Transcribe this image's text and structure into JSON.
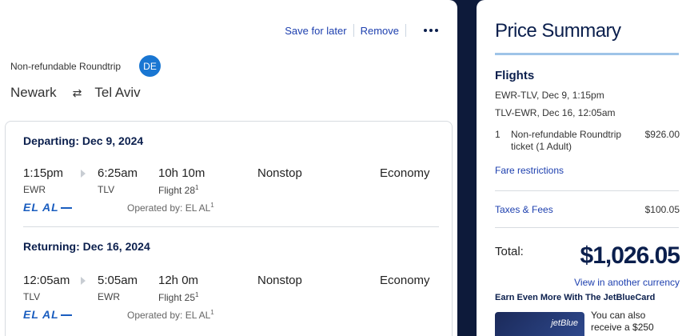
{
  "actions": {
    "save_label": "Save for later",
    "remove_label": "Remove"
  },
  "trip": {
    "type": "Non-refundable Roundtrip",
    "avatar_initials": "DE",
    "origin": "Newark",
    "destination": "Tel Aviv"
  },
  "segments": [
    {
      "title": "Departing: Dec 9, 2024",
      "depart_time": "1:15pm",
      "depart_code": "EWR",
      "arrive_time": "6:25am",
      "arrive_code": "TLV",
      "duration": "10h 10m",
      "flight": "Flight 28",
      "stops": "Nonstop",
      "cabin": "Economy",
      "airline_logo": "EL AL",
      "operated_by": "Operated by: EL AL"
    },
    {
      "title": "Returning: Dec 16, 2024",
      "depart_time": "12:05am",
      "depart_code": "TLV",
      "arrive_time": "5:05am",
      "arrive_code": "EWR",
      "duration": "12h 0m",
      "flight": "Flight 25",
      "stops": "Nonstop",
      "cabin": "Economy",
      "airline_logo": "EL AL",
      "operated_by": "Operated by: EL AL"
    }
  ],
  "footnote_marker": "1",
  "summary": {
    "title": "Price Summary",
    "flights_heading": "Flights",
    "legs": [
      "EWR-TLV, Dec 9, 1:15pm",
      "TLV-EWR, Dec 16, 12:05am"
    ],
    "ticket_qty": "1",
    "ticket_desc": "Non-refundable Roundtrip ticket (1 Adult)",
    "ticket_price": "$926.00",
    "fare_restrictions": "Fare restrictions",
    "taxes_label": "Taxes & Fees",
    "taxes_value": "$100.05",
    "total_label": "Total:",
    "total_value": "$1,026.05",
    "currency_link": "View in another currency",
    "earn_heading": "Earn Even More With The JetBlueCard",
    "card_brand": "jetBlue",
    "card_text": "You can also receive a $250"
  },
  "colors": {
    "brand_navy": "#0b1f4d",
    "link_blue": "#1e40af",
    "avatar_blue": "#1976d2",
    "accent_rule": "#9ec4e8"
  }
}
